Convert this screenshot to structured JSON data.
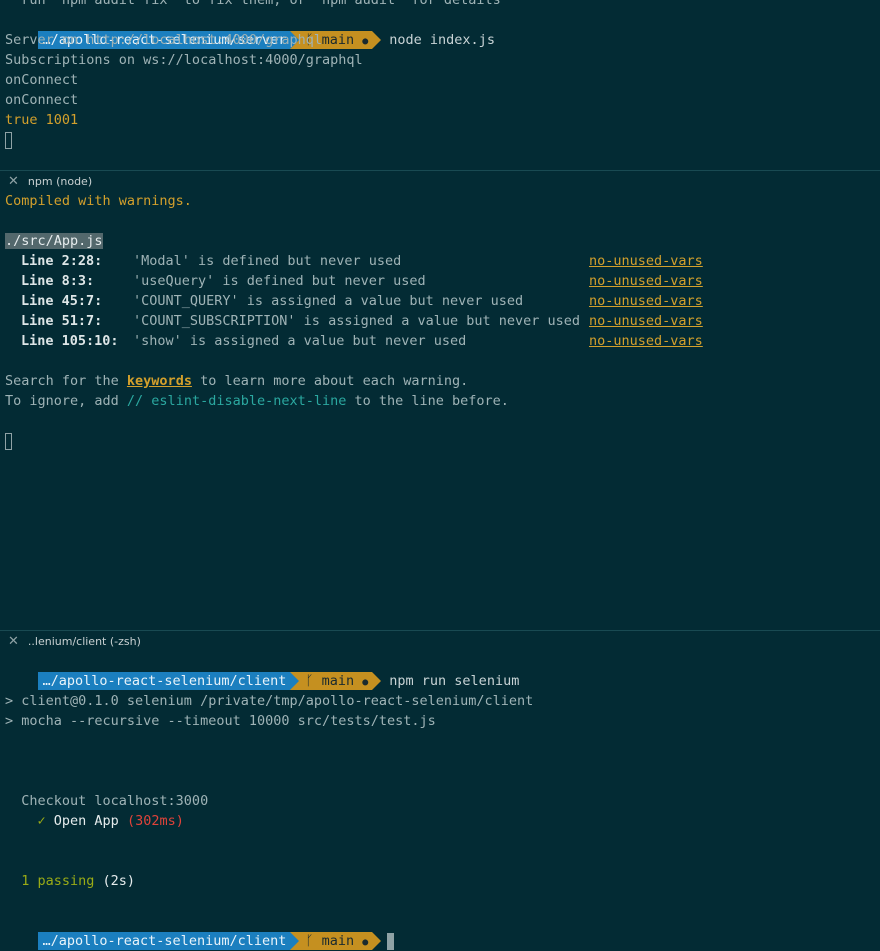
{
  "top_pane": {
    "cut_line": "  run `npm audit fix` to fix them, or `npm audit` for details",
    "prompt": {
      "path": "…/apollo-react-selenium/server",
      "branch": "main",
      "command": "node index.js"
    },
    "output": [
      "Server on http://localhost:4000/graphql",
      "Subscriptions on ws://localhost:4000/graphql",
      "onConnect",
      "onConnect"
    ],
    "highlight_line": "true 1001"
  },
  "mid_pane": {
    "tab_title": "npm (node)",
    "compiled": "Compiled with warnings.",
    "file": "./src/App.js",
    "warnings": [
      {
        "loc": "Line 2:28:",
        "msg": "'Modal' is defined but never used",
        "rule": "no-unused-vars"
      },
      {
        "loc": "Line 8:3:",
        "msg": "'useQuery' is defined but never used",
        "rule": "no-unused-vars"
      },
      {
        "loc": "Line 45:7:",
        "msg": "'COUNT_QUERY' is assigned a value but never used",
        "rule": "no-unused-vars"
      },
      {
        "loc": "Line 51:7:",
        "msg": "'COUNT_SUBSCRIPTION' is assigned a value but never used",
        "rule": "no-unused-vars"
      },
      {
        "loc": "Line 105:10:",
        "msg": "'show' is assigned a value but never used",
        "rule": "no-unused-vars"
      }
    ],
    "search_pre": "Search for the ",
    "search_kw": "keywords",
    "search_post": " to learn more about each warning.",
    "ignore_pre": "To ignore, add ",
    "ignore_code": "// eslint-disable-next-line",
    "ignore_post": " to the line before."
  },
  "bot_pane": {
    "tab_title": "..lenium/client (-zsh)",
    "prompt": {
      "path": "…/apollo-react-selenium/client",
      "branch": "main",
      "command": "npm run selenium"
    },
    "script_lines": [
      "> client@0.1.0 selenium /private/tmp/apollo-react-selenium/client",
      "> mocha --recursive --timeout 10000 src/tests/test.js"
    ],
    "suite": "  Checkout localhost:3000",
    "test_check": "    ✓ ",
    "test_name": "Open App",
    "test_time": " (302ms)",
    "passing_count": "  1 passing",
    "passing_time": " (2s)",
    "prompt2": {
      "path": "…/apollo-react-selenium/client",
      "branch": "main"
    }
  }
}
